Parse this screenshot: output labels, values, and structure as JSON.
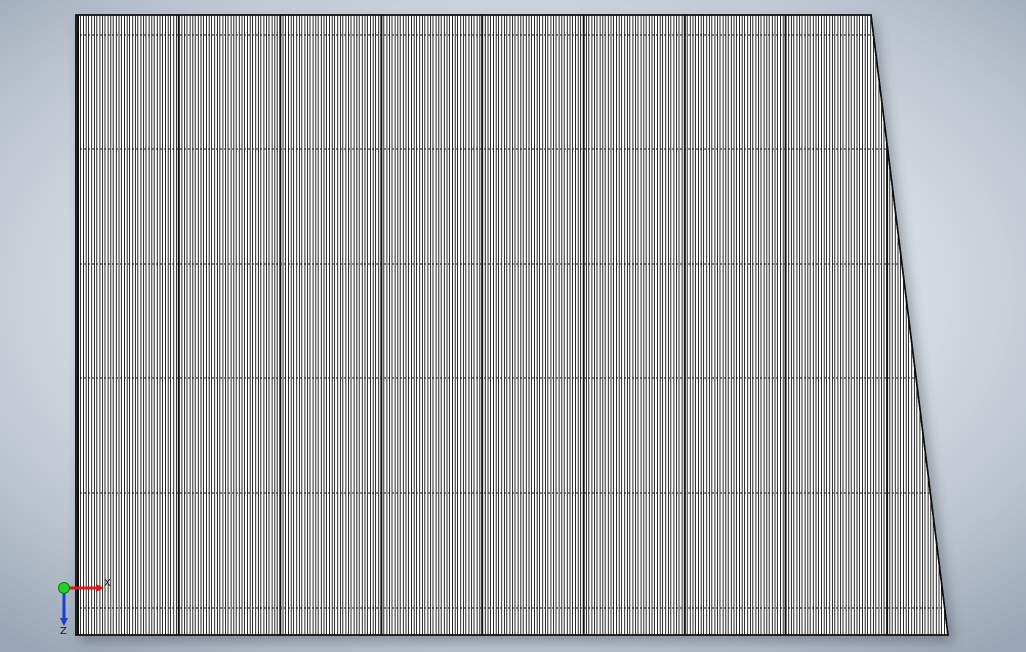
{
  "viewport": {
    "background_top": "#f2f4f7",
    "background_edge": "#9aa6b5"
  },
  "model": {
    "face_color": "#ffffff",
    "line_color": "#111111",
    "shadow_color": "#2a2f36",
    "view": "front"
  },
  "triad": {
    "x_label": "X",
    "z_label": "Z",
    "x_color": "#d81b1b",
    "z_color": "#1a3fd1",
    "origin_color": "#1fd12a"
  }
}
